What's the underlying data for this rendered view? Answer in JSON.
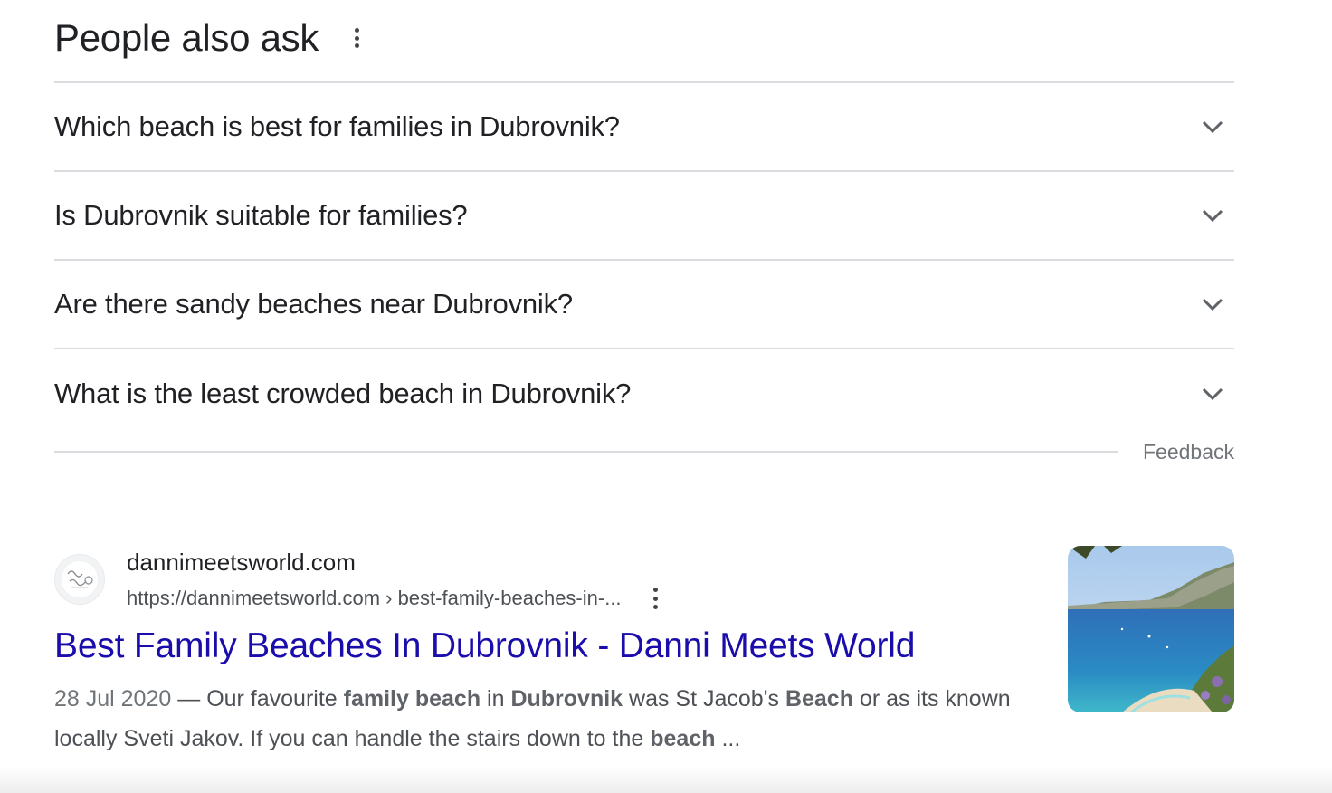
{
  "paa": {
    "title": "People also ask",
    "menu_icon": "more-vert-icon",
    "questions": [
      "Which beach is best for families in Dubrovnik?",
      "Is Dubrovnik suitable for families?",
      "Are there sandy beaches near Dubrovnik?",
      "What is the least crowded beach in Dubrovnik?"
    ],
    "expand_icon": "chevron-down-icon",
    "feedback_label": "Feedback"
  },
  "result": {
    "site_name": "dannimeetsworld.com",
    "url_text": "https://dannimeetsworld.com › best-family-beaches-in-...",
    "title": "Best Family Beaches In Dubrovnik - Danni Meets World",
    "date": "28 Jul 2020",
    "snippet": {
      "dash": " — ",
      "p1": "Our favourite ",
      "b1": "family beach",
      "p2": " in ",
      "b2": "Dubrovnik",
      "p3": " was St Jacob's ",
      "b3": "Beach",
      "p4": " or as its known locally Sveti Jakov. If you can handle the stairs down to the ",
      "b4": "beach",
      "p5": " ..."
    },
    "favicon_icon": "site-logo-icon",
    "thumbnail": "coastal-beach-thumbnail"
  },
  "colors": {
    "link": "#1a0dab",
    "divider": "#dadce0",
    "text": "#202124",
    "muted": "#70757a"
  }
}
